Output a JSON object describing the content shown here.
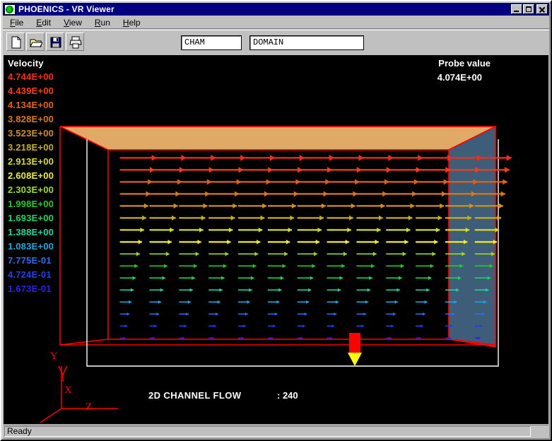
{
  "window": {
    "title": "PHOENICS - VR Viewer",
    "icon": "phoenics-globe-icon",
    "minimize_label": "Minimize",
    "maximize_label": "Maximize",
    "close_label": "Close"
  },
  "menu": {
    "items": [
      {
        "label": "File",
        "accel": "F"
      },
      {
        "label": "Edit",
        "accel": "E"
      },
      {
        "label": "View",
        "accel": "V"
      },
      {
        "label": "Run",
        "accel": "R"
      },
      {
        "label": "Help",
        "accel": "H"
      }
    ]
  },
  "toolbar": {
    "buttons": [
      {
        "name": "new-file-icon",
        "label": "New"
      },
      {
        "name": "open-file-icon",
        "label": "Open"
      },
      {
        "name": "save-file-icon",
        "label": "Save"
      },
      {
        "name": "print-icon",
        "label": "Print"
      }
    ],
    "case_field": {
      "value": "CHAM",
      "placeholder": "CHAM"
    },
    "object_field": {
      "value": "DOMAIN",
      "placeholder": "DOMAIN"
    }
  },
  "canvas": {
    "background": "#000000",
    "legend_title": "Velocity",
    "probe_title": "Probe value",
    "probe_value": "4.074E+00",
    "footer_label": "2D CHANNEL FLOW",
    "footer_step": ": 240",
    "axes": [
      {
        "label": "Y",
        "color": "#ff0000"
      },
      {
        "label": "X",
        "color": "#ff0000"
      },
      {
        "label": "Z",
        "color": "#ff0000"
      }
    ],
    "surfaces": {
      "ceiling_color": "#e0aa66",
      "outlet_color": "#3d5d78",
      "wireframe_color": "#ff0000",
      "inner_wire_color": "#ffffff"
    },
    "probe_marker": {
      "body_color": "#ff0000",
      "tip_color": "#ffff00"
    }
  },
  "legend": {
    "title": "Velocity",
    "entries": [
      {
        "value": "4.744E+00",
        "color": "#ff2a10"
      },
      {
        "value": "4.439E+00",
        "color": "#ff3c10"
      },
      {
        "value": "4.134E+00",
        "color": "#e8600c"
      },
      {
        "value": "3.828E+00",
        "color": "#e07810"
      },
      {
        "value": "3.523E+00",
        "color": "#d49210"
      },
      {
        "value": "3.218E+00",
        "color": "#cbb010"
      },
      {
        "value": "2.913E+00",
        "color": "#d7e015"
      },
      {
        "value": "2.608E+00",
        "color": "#f2f215"
      },
      {
        "value": "2.303E+00",
        "color": "#9ce015"
      },
      {
        "value": "1.998E+00",
        "color": "#22cc22"
      },
      {
        "value": "1.693E+00",
        "color": "#18d95c"
      },
      {
        "value": "1.388E+00",
        "color": "#16d9a0"
      },
      {
        "value": "1.083E+00",
        "color": "#18a8e0"
      },
      {
        "value": "7.775E-01",
        "color": "#2a6ef0"
      },
      {
        "value": "4.724E-01",
        "color": "#2040f0"
      },
      {
        "value": "1.673E-01",
        "color": "#2a1ef0"
      }
    ]
  },
  "chart_data": {
    "type": "scatter",
    "title": "2D CHANNEL FLOW",
    "subtitle": ": 240",
    "variable": "Velocity",
    "colorbar_label": "Velocity",
    "colorbar_ticks": [
      "4.744E+00",
      "4.439E+00",
      "4.134E+00",
      "3.828E+00",
      "3.523E+00",
      "3.218E+00",
      "2.913E+00",
      "2.608E+00",
      "2.303E+00",
      "1.998E+00",
      "1.693E+00",
      "1.388E+00",
      "1.083E+00",
      "7.775E-01",
      "4.724E-01",
      "1.673E-01"
    ],
    "colorbar_range": [
      0.1673,
      4.744
    ],
    "probe_value": 4.074,
    "vector_grid_columns": 13,
    "vector_grid_rows": 16,
    "row_speeds": [
      0.17,
      0.47,
      0.78,
      1.08,
      1.39,
      1.69,
      2.0,
      2.3,
      2.61,
      2.91,
      3.22,
      3.52,
      3.83,
      4.13,
      4.44,
      4.74
    ],
    "row_colors": [
      "#2a1ef0",
      "#2040f0",
      "#2a6ef0",
      "#18a8e0",
      "#16d9a0",
      "#18d95c",
      "#22cc22",
      "#9ce015",
      "#f2f215",
      "#d7e015",
      "#cbb010",
      "#d49210",
      "#e07810",
      "#e8600c",
      "#ff3c10",
      "#ff2a10"
    ],
    "xlabel": "Z",
    "ylabel": "Y",
    "grid": false,
    "legend_position": "left"
  },
  "statusbar": {
    "message": "Ready"
  }
}
